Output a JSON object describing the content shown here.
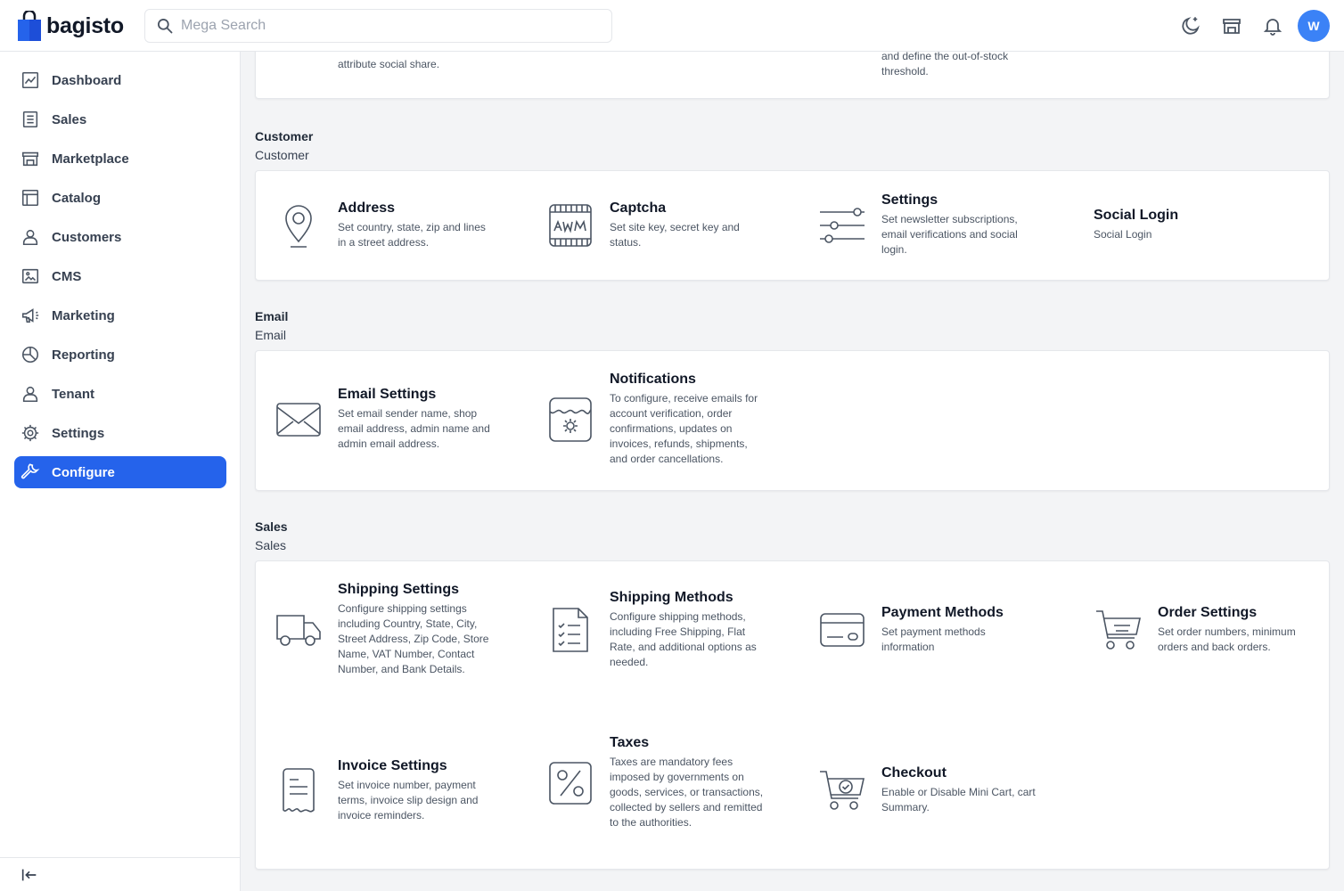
{
  "brand": {
    "name": "bagisto",
    "color": "#2563eb"
  },
  "search": {
    "placeholder": "Mega Search"
  },
  "header_icons": [
    "dark-mode-icon",
    "storefront-icon",
    "notification-bell-icon"
  ],
  "user": {
    "initial": "W"
  },
  "sidebar": {
    "items": [
      {
        "label": "Dashboard",
        "icon": "dashboard-icon"
      },
      {
        "label": "Sales",
        "icon": "sales-icon"
      },
      {
        "label": "Marketplace",
        "icon": "marketplace-icon"
      },
      {
        "label": "Catalog",
        "icon": "catalog-icon"
      },
      {
        "label": "Customers",
        "icon": "customers-icon"
      },
      {
        "label": "CMS",
        "icon": "cms-icon"
      },
      {
        "label": "Marketing",
        "icon": "marketing-icon"
      },
      {
        "label": "Reporting",
        "icon": "reporting-icon"
      },
      {
        "label": "Tenant",
        "icon": "tenant-icon"
      },
      {
        "label": "Settings",
        "icon": "settings-icon"
      },
      {
        "label": "Configure",
        "icon": "configure-icon",
        "active": true
      }
    ]
  },
  "top_partial": {
    "left_text": "attribute social share.",
    "right_text_1": "and define the out-of-stock",
    "right_text_2": "threshold."
  },
  "sections": {
    "customer": {
      "title": "Customer",
      "subtitle": "Customer",
      "items": [
        {
          "title": "Address",
          "desc": "Set country, state, zip and lines in a street address.",
          "icon": "location-pin-icon"
        },
        {
          "title": "Captcha",
          "desc": "Set site key, secret key and status.",
          "icon": "captcha-icon"
        },
        {
          "title": "Settings",
          "desc": "Set newsletter subscriptions, email verifications and social login.",
          "icon": "sliders-icon"
        },
        {
          "title": "Social Login",
          "desc": "Social Login",
          "icon": ""
        }
      ]
    },
    "email": {
      "title": "Email",
      "subtitle": "Email",
      "items": [
        {
          "title": "Email Settings",
          "desc": "Set email sender name, shop email address, admin name and admin email address.",
          "icon": "envelope-icon"
        },
        {
          "title": "Notifications",
          "desc": "To configure, receive emails for account verification, order confirmations, updates on invoices, refunds, shipments, and order cancellations.",
          "icon": "notification-settings-icon"
        }
      ]
    },
    "sales": {
      "title": "Sales",
      "subtitle": "Sales",
      "items": [
        {
          "title": "Shipping Settings",
          "desc": "Configure shipping settings including Country, State, City, Street Address, Zip Code, Store Name, VAT Number, Contact Number, and Bank Details.",
          "icon": "truck-icon"
        },
        {
          "title": "Shipping Methods",
          "desc": "Configure shipping methods, including Free Shipping, Flat Rate, and additional options as needed.",
          "icon": "checklist-icon"
        },
        {
          "title": "Payment Methods",
          "desc": "Set payment methods information",
          "icon": "credit-card-icon"
        },
        {
          "title": "Order Settings",
          "desc": "Set order numbers, minimum orders and back orders.",
          "icon": "cart-icon"
        },
        {
          "title": "Invoice Settings",
          "desc": "Set invoice number, payment terms, invoice slip design and invoice reminders.",
          "icon": "invoice-icon"
        },
        {
          "title": "Taxes",
          "desc": "Taxes are mandatory fees imposed by governments on goods, services, or transactions, collected by sellers and remitted to the authorities.",
          "icon": "percent-icon"
        },
        {
          "title": "Checkout",
          "desc": "Enable or Disable Mini Cart, cart Summary.",
          "icon": "cart-check-icon"
        }
      ]
    }
  }
}
